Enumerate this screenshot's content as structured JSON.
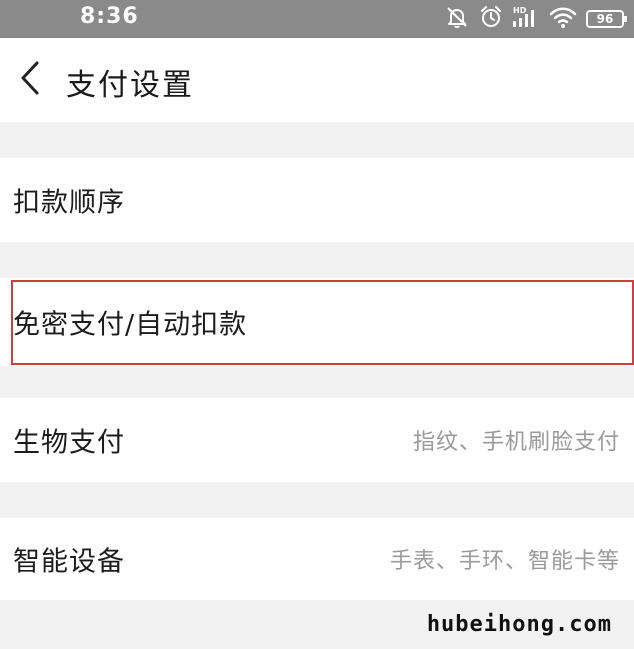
{
  "status_bar": {
    "time": "8:36",
    "network_label": "HD",
    "battery": "96",
    "icons": [
      "silent-icon",
      "alarm-icon",
      "signal-icon",
      "wifi-icon",
      "battery-icon"
    ]
  },
  "header": {
    "back_icon": "back-chevron-icon",
    "title": "支付设置"
  },
  "settings": {
    "items": [
      {
        "label": "扣款顺序",
        "desc": ""
      },
      {
        "label": "免密支付/自动扣款",
        "desc": ""
      },
      {
        "label": "生物支付",
        "desc": "指纹、手机刷脸支付"
      },
      {
        "label": "智能设备",
        "desc": "手表、手环、智能卡等"
      }
    ]
  },
  "annotation": {
    "highlight_color": "#c8403f"
  },
  "watermark": "hubeihong.com"
}
